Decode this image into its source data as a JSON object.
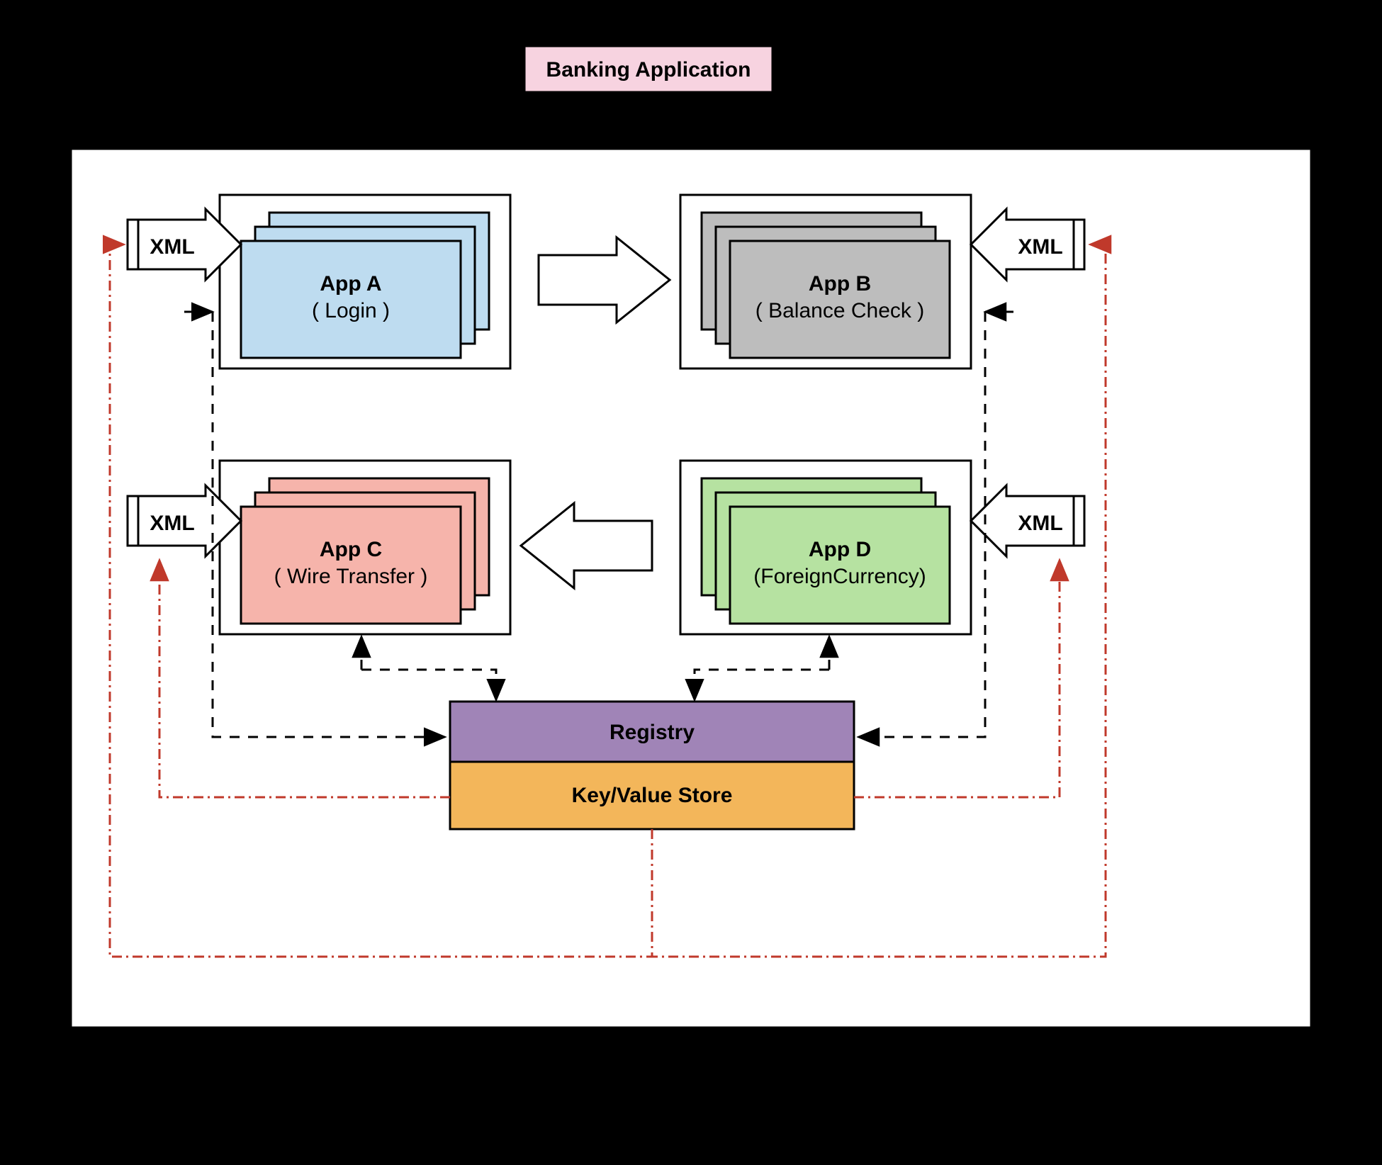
{
  "title": "Banking Application",
  "apps": {
    "a": {
      "name": "App A",
      "desc": "( Login )",
      "fill": "#bedcf0"
    },
    "b": {
      "name": "App B",
      "desc": "( Balance Check )",
      "fill": "#bdbdbd"
    },
    "c": {
      "name": "App C",
      "desc": "( Wire Transfer )",
      "fill": "#f6b4ab"
    },
    "d": {
      "name": "App D",
      "desc": "(ForeignCurrency)",
      "fill": "#b6e2a1"
    }
  },
  "xml_label": "XML",
  "registry_label": "Registry",
  "kv_label": "Key/Value Store",
  "colors": {
    "title_fill": "#f7d3e0",
    "registry_fill": "#a084b7",
    "kv_fill": "#f3b65a",
    "red": "#c0392b"
  }
}
